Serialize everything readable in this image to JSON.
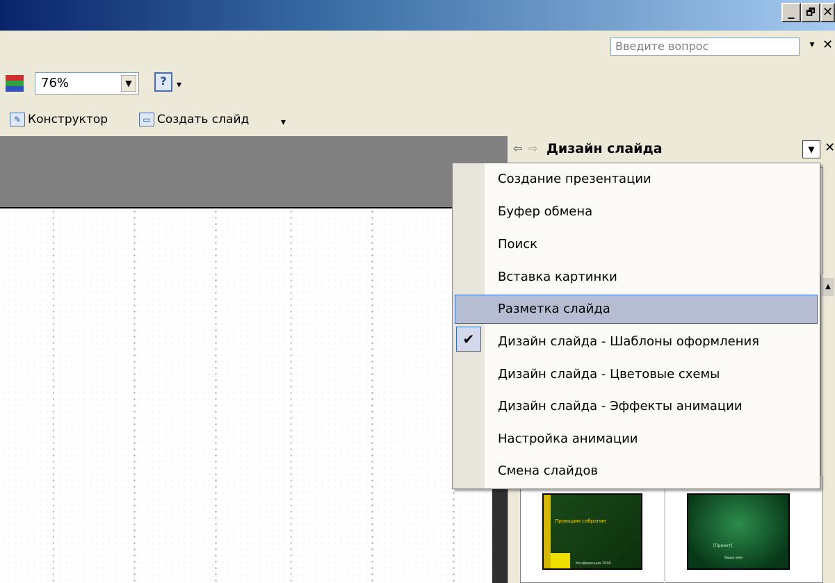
{
  "window": {
    "controls": {
      "minimize": "_",
      "restore": "🗗",
      "close": "✕"
    }
  },
  "ask": {
    "placeholder": "Введите вопрос",
    "drop": "▾",
    "close": "✕"
  },
  "toolbar1": {
    "zoom_value": "76%",
    "zoom_drop": "▼",
    "help": "?",
    "more": "▾"
  },
  "toolbar2": {
    "designer_label": "Конструктор",
    "new_slide_label": "Создать слайд",
    "more": "▾"
  },
  "taskpane": {
    "back": "⇦",
    "forward": "⇨",
    "title": "Дизайн слайда",
    "drop": "▼",
    "close": "✕"
  },
  "menu": {
    "items": [
      {
        "label": "Создание презентации"
      },
      {
        "label": "Буфер обмена"
      },
      {
        "label": "Поиск"
      },
      {
        "label": "Вставка картинки"
      },
      {
        "label": "Разметка слайда",
        "highlighted": true
      },
      {
        "label": "Дизайн слайда - Шаблоны оформления",
        "checked": true
      },
      {
        "label": "Дизайн слайда - Цветовые схемы"
      },
      {
        "label": "Дизайн слайда - Эффекты анимации"
      },
      {
        "label": "Настройка анимации"
      },
      {
        "label": "Смена слайдов"
      }
    ],
    "check_mark": "✔"
  },
  "thumbnails": [
    {
      "title": "Проводим собрание",
      "subtitle": "Конференция 2000"
    },
    {
      "title": "[Проект]",
      "subtitle": "Ваше имя"
    }
  ],
  "colors": {
    "title_gradient_start": "#0a246a",
    "highlight": "#b6bdd2",
    "check_bg": "#d3d9eb"
  }
}
